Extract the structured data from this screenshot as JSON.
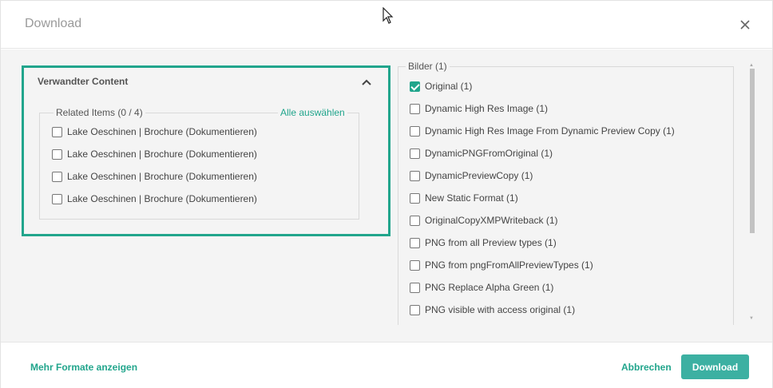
{
  "dialog": {
    "title": "Download"
  },
  "related_panel": {
    "title": "Verwandter Content",
    "legend": "Related Items (0 / 4)",
    "select_all": "Alle auswählen",
    "items": [
      {
        "label": "Lake Oeschinen | Brochure (Dokumentieren)",
        "checked": false
      },
      {
        "label": "Lake Oeschinen | Brochure (Dokumentieren)",
        "checked": false
      },
      {
        "label": "Lake Oeschinen | Brochure (Dokumentieren)",
        "checked": false
      },
      {
        "label": "Lake Oeschinen | Brochure (Dokumentieren)",
        "checked": false
      }
    ]
  },
  "formats_panel": {
    "legend": "Bilder (1)",
    "items": [
      {
        "label": "Original (1)",
        "checked": true
      },
      {
        "label": "Dynamic High Res Image (1)",
        "checked": false
      },
      {
        "label": "Dynamic High Res Image From Dynamic Preview Copy (1)",
        "checked": false
      },
      {
        "label": "DynamicPNGFromOriginal (1)",
        "checked": false
      },
      {
        "label": "DynamicPreviewCopy (1)",
        "checked": false
      },
      {
        "label": "New Static Format (1)",
        "checked": false
      },
      {
        "label": "OriginalCopyXMPWriteback (1)",
        "checked": false
      },
      {
        "label": "PNG from all Preview types (1)",
        "checked": false
      },
      {
        "label": "PNG from pngFromAllPreviewTypes (1)",
        "checked": false
      },
      {
        "label": "PNG Replace Alpha Green (1)",
        "checked": false
      },
      {
        "label": "PNG visible with access original (1)",
        "checked": false
      }
    ]
  },
  "footer": {
    "more_formats": "Mehr Formate anzeigen",
    "cancel": "Abbrechen",
    "download": "Download"
  },
  "colors": {
    "accent": "#21a58c",
    "button": "#3cb0a2",
    "body_bg": "#f4f4f4"
  },
  "icons": [
    "close-icon",
    "chevron-up-icon",
    "mouse-cursor-icon",
    "checkmark-icon"
  ]
}
